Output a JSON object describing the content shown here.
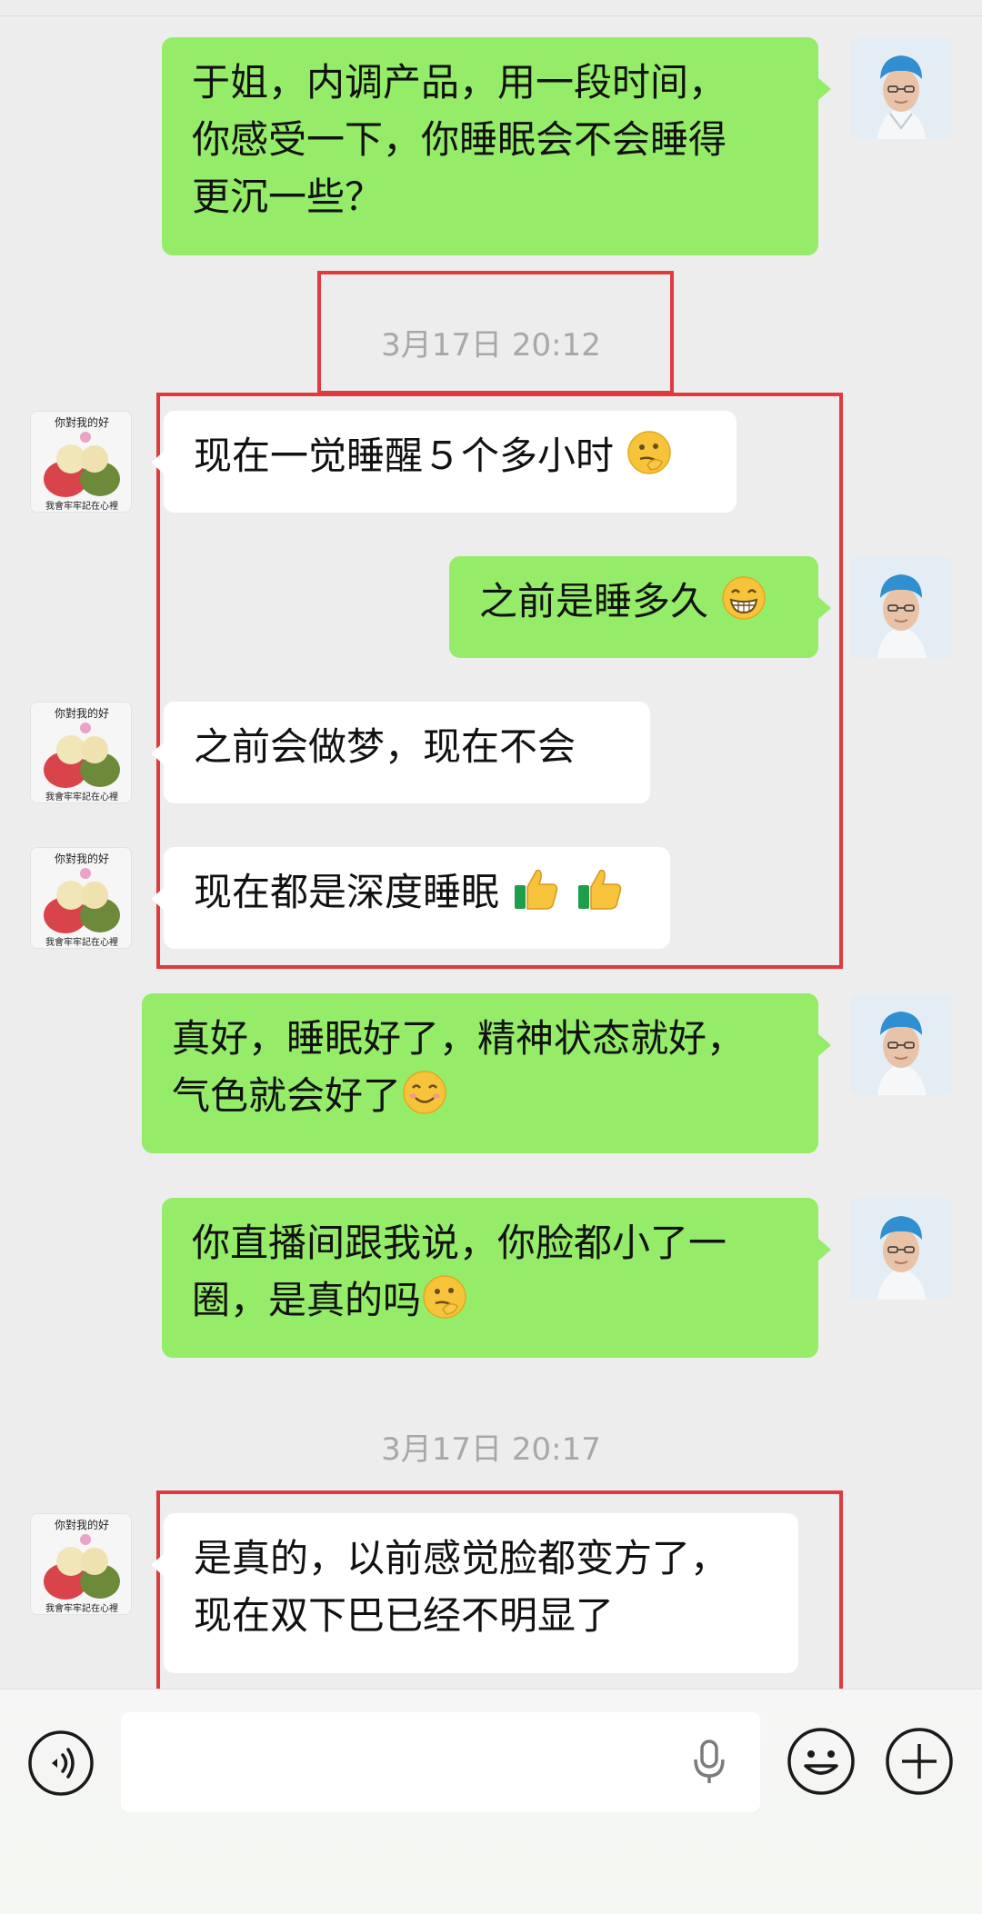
{
  "messages": {
    "m1": {
      "lines": [
        "于姐，内调产品，用一段时间，",
        "你感受一下，你睡眠会不会睡得",
        "更沉一些？"
      ]
    },
    "ts1": "3月17日 20:12",
    "m2": {
      "text": "现在一觉睡醒５个多小时",
      "emoji": "thinking-face"
    },
    "m3": {
      "text": "之前是睡多久",
      "emoji": "grinning-face"
    },
    "m4": {
      "text": "之前会做梦，现在不会"
    },
    "m5": {
      "text": "现在都是深度睡眠",
      "emoji": "thumbs-up x2"
    },
    "m6": {
      "lines": [
        "真好，睡眠好了，精神状态就好，",
        "气色就会好了"
      ],
      "emoji": "smiling-face"
    },
    "m7": {
      "lines": [
        "你直播间跟我说，你脸都小了一",
        "圈，是真的吗"
      ],
      "emoji": "thinking-face"
    },
    "ts2": "3月17日 20:17",
    "m8": {
      "lines": [
        "是真的，以前感觉脸都变方了，",
        "现在双下巴已经不明显了"
      ]
    }
  },
  "avatar_caption": {
    "top": "你對我的好",
    "bottom": "我會牢牢記在心裡"
  },
  "colors": {
    "green_bubble": "#95ec69",
    "white_bubble": "#ffffff",
    "annotation_red": "#e0393e",
    "background": "#ededed"
  },
  "input_bar": {
    "icons": [
      "voice-icon",
      "microphone-icon",
      "emoji-icon",
      "plus-icon"
    ]
  }
}
